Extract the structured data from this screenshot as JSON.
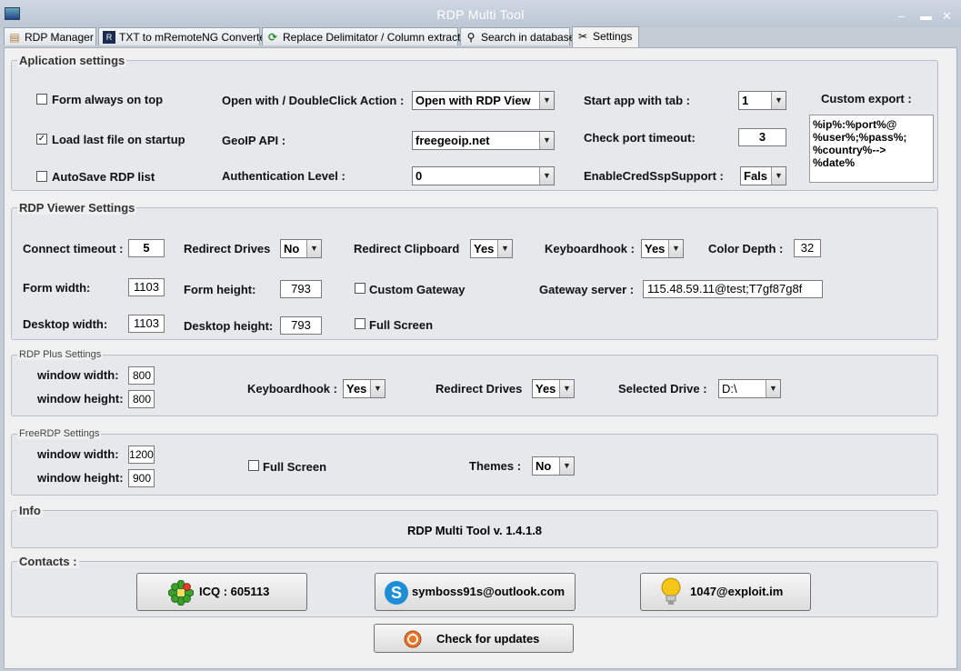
{
  "window": {
    "title": "RDP Multi Tool",
    "minimize": "–",
    "close": "✕"
  },
  "tabs": [
    {
      "label": "RDP Manager",
      "icon": "database-icon"
    },
    {
      "label": "TXT to mRemoteNG Converter",
      "icon": "converter-icon"
    },
    {
      "label": "Replace Delimitator / Column extractor",
      "icon": "refresh-icon"
    },
    {
      "label": "Search in database",
      "icon": "search-icon"
    },
    {
      "label": "Settings",
      "icon": "settings-icon"
    }
  ],
  "app_settings": {
    "legend": "Aplication settings",
    "form_always_on_top": {
      "label": "Form always on top",
      "checked": false
    },
    "load_last_file": {
      "label": "Load last file on startup",
      "checked": true,
      "mark": "✓"
    },
    "autosave": {
      "label": "AutoSave RDP list",
      "checked": false
    },
    "open_with_label": "Open with / DoubleClick Action :",
    "open_with_value": "Open with RDP View",
    "geoip_label": "GeoIP API :",
    "geoip_value": "freegeoip.net",
    "auth_label": "Authentication Level :",
    "auth_value": "0",
    "start_tab_label": "Start app with tab :",
    "start_tab_value": "1",
    "port_timeout_label": "Check port timeout:",
    "port_timeout_value": "3",
    "credssp_label": "EnableCredSspSupport  :",
    "credssp_value": "Fals",
    "custom_export_label": "Custom export :",
    "custom_export_value": "%ip%:%port%@\n%user%;%pass%;\n%country%-->\n%date%"
  },
  "rdp_viewer": {
    "legend": "RDP Viewer Settings",
    "connect_timeout_label": "Connect timeout :",
    "connect_timeout_value": "5",
    "redirect_drives_label": "Redirect Drives",
    "redirect_drives_value": "No",
    "redirect_clipboard_label": "Redirect Clipboard",
    "redirect_clipboard_value": "Yes",
    "keyboardhook_label": "Keyboardhook :",
    "keyboardhook_value": "Yes",
    "color_depth_label": "Color Depth :",
    "color_depth_value": "32",
    "form_width_label": "Form width:",
    "form_width_value": "1103",
    "form_height_label": "Form height:",
    "form_height_value": "793",
    "custom_gateway_label": "Custom Gateway",
    "gateway_server_label": "Gateway server :",
    "gateway_server_value": "115.48.59.11@test;T7gf87g8f",
    "desktop_width_label": "Desktop width:",
    "desktop_width_value": "1103",
    "desktop_height_label": "Desktop height:",
    "desktop_height_value": "793",
    "full_screen_label": "Full Screen"
  },
  "rdp_plus": {
    "legend": "RDP Plus Settings",
    "window_width_label": "window width:",
    "window_width_value": "800",
    "window_height_label": "window height:",
    "window_height_value": "800",
    "keyboardhook_label": "Keyboardhook :",
    "keyboardhook_value": "Yes",
    "redirect_drives_label": "Redirect Drives",
    "redirect_drives_value": "Yes",
    "selected_drive_label": "Selected Drive :",
    "selected_drive_value": "D:\\"
  },
  "freerdp": {
    "legend": "FreeRDP Settings",
    "window_width_label": "window width:",
    "window_width_value": "1200",
    "window_height_label": "window height:",
    "window_height_value": "900",
    "full_screen_label": "Full Screen",
    "themes_label": "Themes :",
    "themes_value": "No"
  },
  "info": {
    "legend": "Info",
    "version": "RDP Multi Tool v. 1.4.1.8"
  },
  "contacts": {
    "legend": "Contacts :",
    "icq": "ICQ : 605113",
    "skype": "symboss91s@outlook.com",
    "jabber": "1047@exploit.im",
    "updates": "Check for updates"
  },
  "colors": {
    "icq": "#3ba02a",
    "skype": "#1e8fd6",
    "bulb": "#f5c518",
    "update": "#e8772b"
  }
}
